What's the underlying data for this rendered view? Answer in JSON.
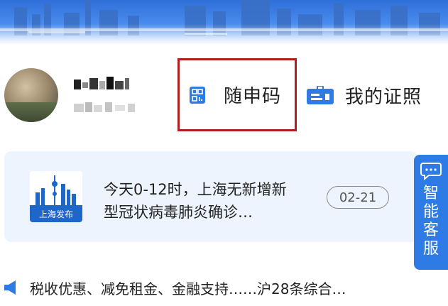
{
  "profile": {
    "name": "",
    "sub": ""
  },
  "actions": {
    "qr_label": "随申码",
    "cert_label": "我的证照"
  },
  "news": {
    "logo_text": "上海发布",
    "headline": "今天0-12时，上海无新增新型冠状病毒肺炎确诊…",
    "date": "02-21"
  },
  "service_tab": {
    "label": "智能客服"
  },
  "ticker": {
    "text": "税收优惠、减免租金、金融支持……沪28条综合…"
  },
  "colors": {
    "accent_blue": "#2e7be6",
    "highlight_red": "#b01e22",
    "card_bg": "#eef4fd"
  },
  "icons": [
    "qr-code-icon",
    "id-card-icon",
    "chat-bubble-icon",
    "speaker-icon"
  ]
}
